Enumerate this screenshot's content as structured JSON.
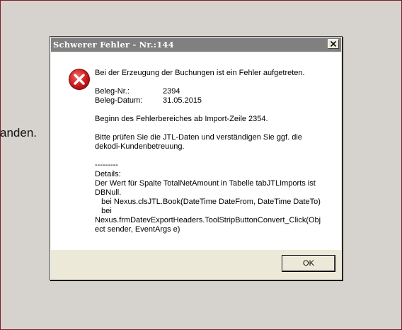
{
  "background": {
    "partial_text": "anden."
  },
  "dialog": {
    "title": "Schwerer Fehler - Nr.:144",
    "close_label": "×",
    "message": {
      "line1": "Bei der Erzeugung der Buchungen ist ein Fehler aufgetreten.",
      "beleg_nr_label": "Beleg-Nr.:",
      "beleg_nr_value": "2394",
      "beleg_datum_label": "Beleg-Datum:",
      "beleg_datum_value": "31.05.2015",
      "line_beginn": "Beginn des Fehlerbereiches ab Import-Zeile 2354.",
      "line_pruefen_1": "Bitte prüfen Sie die JTL-Daten und verständigen Sie ggf. die",
      "line_pruefen_2": "dekodi-Kundenbetreuung.",
      "separator": "---------",
      "details_label": "Details:",
      "details_1": "Der Wert für Spalte TotalNetAmount in Tabelle tabJTLImports ist",
      "details_2": "DBNull.",
      "details_3": "   bei Nexus.clsJTL.Book(DateTime DateFrom, DateTime DateTo)",
      "details_4": "   bei",
      "details_5": "Nexus.frmDatevExportHeaders.ToolStripButtonConvert_Click(Obj",
      "details_6": "ect sender, EventArgs e)"
    },
    "ok_label": "OK",
    "icon": "error-icon"
  },
  "colors": {
    "titlebar": "#808080",
    "error_red": "#c8161d",
    "dialog_face": "#ece9d8",
    "frame": "#7a1f25"
  }
}
